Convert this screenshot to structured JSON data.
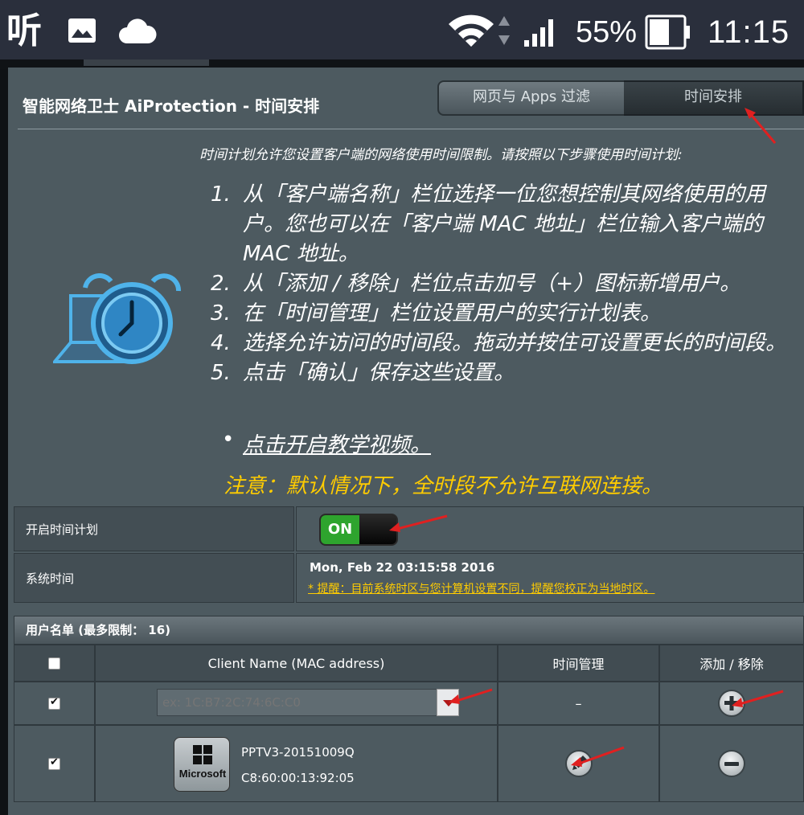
{
  "status_bar": {
    "app_icon_text": "听",
    "battery_percent": "55%",
    "time": "11:15"
  },
  "page": {
    "title": "智能网络卫士 AiProtection - 时间安排",
    "tabs": [
      {
        "label": "网页与 Apps 过滤"
      },
      {
        "label": "时间安排"
      }
    ],
    "intro": "时间计划允许您设置客户端的网络使用时间限制。请按照以下步骤使用时间计划:",
    "steps": [
      {
        "num": "1.",
        "text": "从「客户端名称」栏位选择一位您想控制其网络使用的用户。您也可以在「客户端 MAC 地址」栏位输入客户端的 MAC 地址。"
      },
      {
        "num": "2.",
        "text": "从「添加 / 移除」栏位点击加号（+）图标新增用户。"
      },
      {
        "num": "3.",
        "text": "在「时间管理」栏位设置用户的实行计划表。"
      },
      {
        "num": "4.",
        "text": "选择允许访问的时间段。拖动并按住可设置更长的时间段。"
      },
      {
        "num": "5.",
        "text": "点击「确认」保存这些设置。"
      }
    ],
    "tutorial_bullet": "•",
    "tutorial_link": "点击开启教学视频。",
    "notice": "注意：默认情况下，全时段不允许互联网连接。"
  },
  "settings": {
    "enable_label": "开启时间计划",
    "toggle_on_label": "ON",
    "toggle_state": "on",
    "systime_label": "系统时间",
    "systime_value": "Mon, Feb 22 03:15:58 2016",
    "systime_warning": "* 提醒：目前系统时区与您计算机设置不同，提醒您校正为当地时区。"
  },
  "user_list": {
    "header": "用户名单 (最多限制： 16)",
    "columns": [
      "Client Name (MAC address)",
      "时间管理",
      "添加 / 移除"
    ],
    "input_row": {
      "checked": true,
      "placeholder": "ex: 1C:B7:2C:74:6C:C0",
      "time_mgmt": "–"
    },
    "clients": [
      {
        "checked": true,
        "vendor": "Microsoft",
        "name": "PPTV3-20151009Q",
        "mac": "C8:60:00:13:92:05"
      }
    ]
  },
  "colors": {
    "panel_bg": "#4d5a60",
    "status_bar_bg": "#2a2f3c",
    "notice": "#ffcc00",
    "toggle_on": "#2ea42e",
    "annotation_arrow": "#e02020"
  }
}
